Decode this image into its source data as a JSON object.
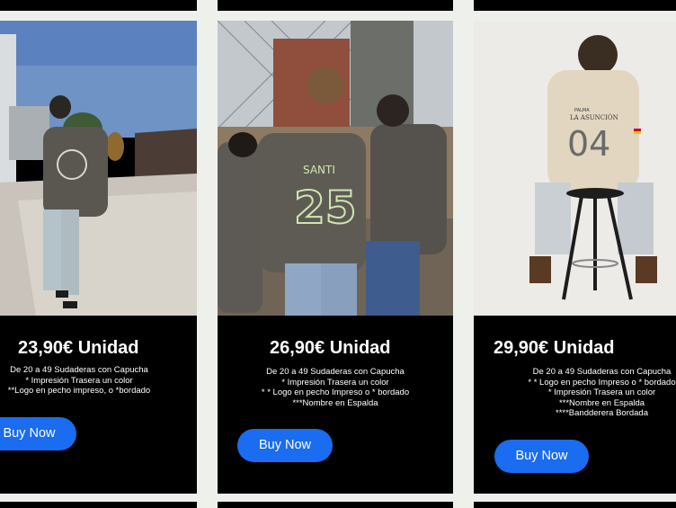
{
  "cards": [
    {
      "price": "23,90€ Unidad",
      "lines": [
        "De 20 a 49 Sudaderas con Capucha",
        "* Impresión Trasera un color",
        "**Logo en pecho impreso, o *bordado"
      ],
      "button": "Buy Now",
      "image_alt": "Person walking away wearing dark grey hoodie with round back logo"
    },
    {
      "price": "26,90€ Unidad",
      "lines": [
        "De 20 a 49 Sudaderas con Capucha",
        "* Impresión Trasera un color",
        "* * Logo en pecho Impreso o * bordado",
        "***Nombre en Espalda"
      ],
      "button": "Buy Now",
      "back_print_name": "SANTI",
      "back_print_number": "25",
      "image_alt": "Three young people in dark grey hoodies near a fence"
    },
    {
      "price": "29,90€ Unidad",
      "lines": [
        "De 20 a 49 Sudaderas con Capucha",
        "* * Logo en pecho Impreso o * bordado",
        "* Impresión Trasera un color",
        "***Nombre en Espalda",
        "****Bandderera Bordada"
      ],
      "button": "Buy Now",
      "back_print_small": "PALMA",
      "back_print_name": "LA ASUNCIÓN",
      "back_print_number": "04",
      "image_alt": "Person seated on a stool wearing a cream hoodie"
    }
  ],
  "colors": {
    "page_bg": "#eef0ec",
    "card_bg": "#000000",
    "button": "#1a6cf0",
    "text": "#ffffff"
  }
}
